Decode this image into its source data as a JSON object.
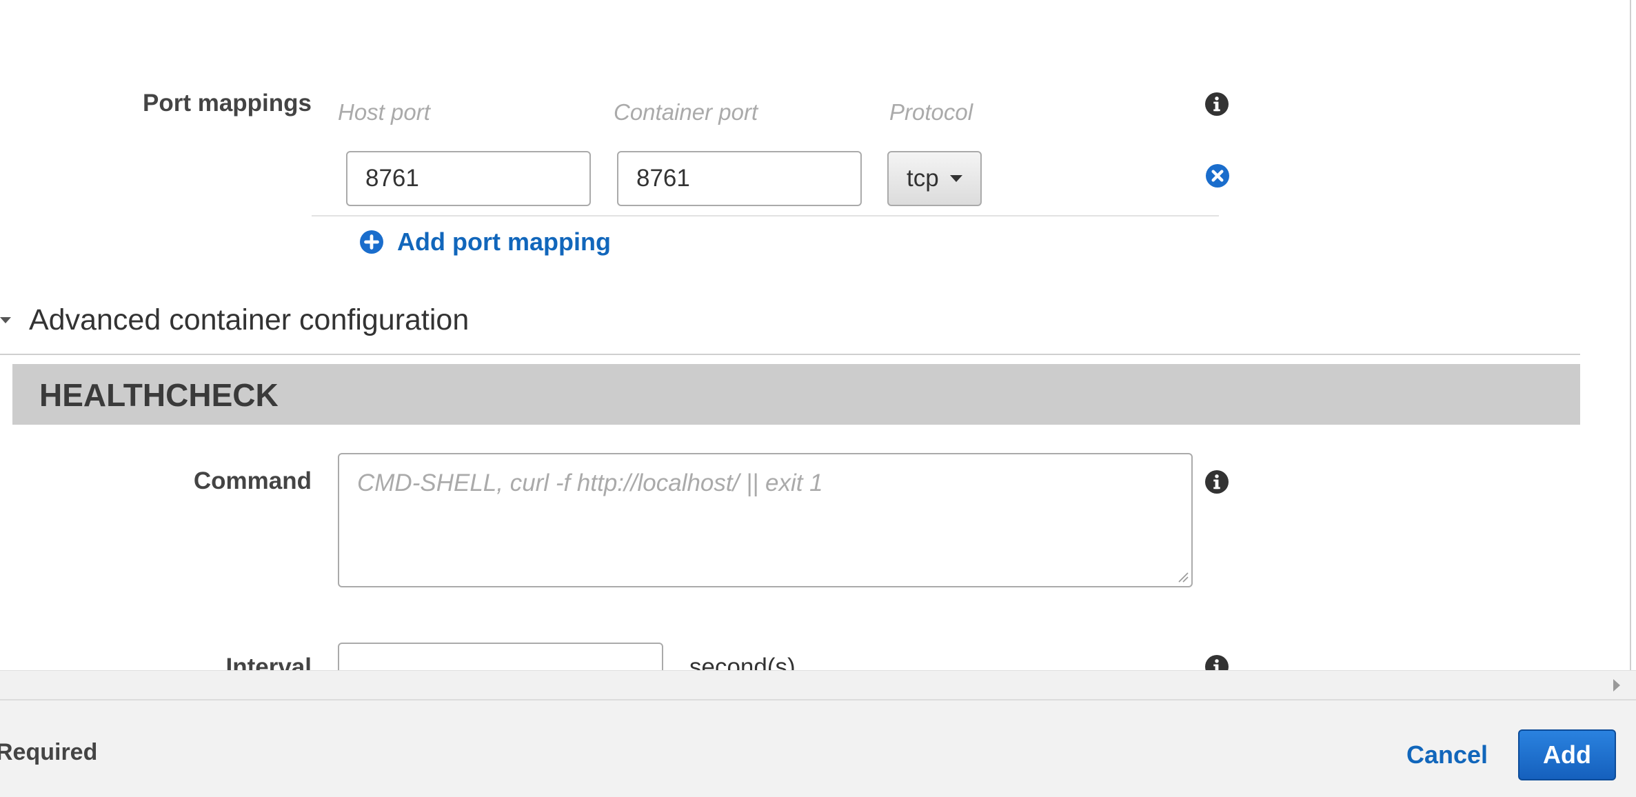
{
  "port_mappings": {
    "label": "Port mappings",
    "headers": {
      "host_port": "Host port",
      "container_port": "Container port",
      "protocol": "Protocol"
    },
    "rows": [
      {
        "host_port": "8761",
        "container_port": "8761",
        "protocol": "tcp"
      }
    ],
    "add_label": "Add port mapping"
  },
  "advanced": {
    "title": "Advanced container configuration"
  },
  "healthcheck": {
    "title": "HEALTHCHECK",
    "command_label": "Command",
    "command_placeholder": "CMD-SHELL, curl -f http://localhost/ || exit 1",
    "interval_label": "Interval",
    "interval_unit": "second(s)"
  },
  "footer": {
    "required_text": "Required",
    "cancel_label": "Cancel",
    "add_label": "Add"
  },
  "colors": {
    "link": "#1166bb",
    "primary": "#1a6dcc",
    "section_band": "#cccccc"
  }
}
